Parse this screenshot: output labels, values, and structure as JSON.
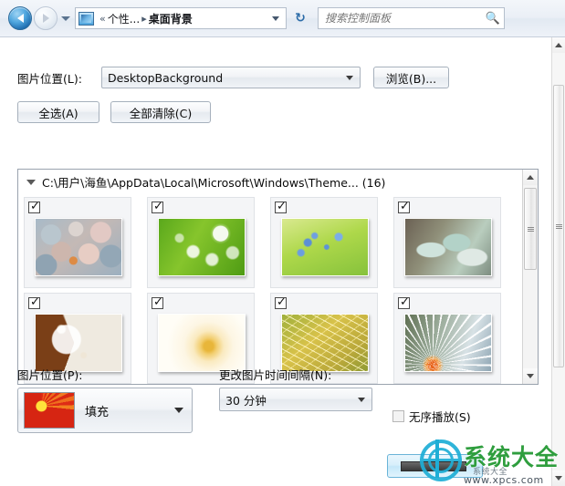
{
  "window": {
    "nav": {
      "back_tooltip": "后退",
      "forward_tooltip": "前进",
      "recent_pages_tooltip": "最近浏览的位置",
      "refresh_label": "↻",
      "address_icon": "personalization-monitor-icon",
      "breadcrumb_overflow": "«",
      "breadcrumb": [
        "个性...",
        "桌面背景"
      ],
      "breadcrumb_separator": "▸"
    },
    "search": {
      "placeholder": "搜索控制面板",
      "value": "",
      "icon": "search-icon"
    }
  },
  "picture_location": {
    "label": "图片位置(L):",
    "value": "DesktopBackground",
    "browse_button": "浏览(B)..."
  },
  "selection_buttons": {
    "select_all": "全选(A)",
    "clear_all": "全部清除(C)"
  },
  "picture_list": {
    "group_header": "C:\\用户\\海鱼\\AppData\\Local\\Microsoft\\Windows\\Theme... (16)",
    "group_expanded": true,
    "thumbnails": [
      {
        "name": "pebbles-stones",
        "checked": true
      },
      {
        "name": "green-leaf-water-drops",
        "checked": true
      },
      {
        "name": "blue-flowers-green-grass",
        "checked": true
      },
      {
        "name": "frosted-green-plants",
        "checked": true
      },
      {
        "name": "brown-spotted-shell",
        "checked": true
      },
      {
        "name": "yellow-white-rose",
        "checked": true
      },
      {
        "name": "golden-grass-strands",
        "checked": true
      },
      {
        "name": "dandelion-starburst",
        "checked": true
      }
    ],
    "scrollbar": {
      "up": "▲",
      "down": "▼"
    }
  },
  "bottom": {
    "position_label": "图片位置(P):",
    "position_value": "填充",
    "interval_label": "更改图片时间间隔(N):",
    "interval_value": "30 分钟",
    "shuffle_label": "无序播放(S)",
    "shuffle_checked": false
  },
  "watermark": {
    "title": "系统大全",
    "subtitle": "系统大全",
    "url": "www.xpcs.com"
  },
  "colors": {
    "accent": "#1eaed6",
    "watermark_green": "#2f9e3e",
    "chrome_border": "#a9b2bd",
    "highlight_button": "#6ab4d8"
  }
}
